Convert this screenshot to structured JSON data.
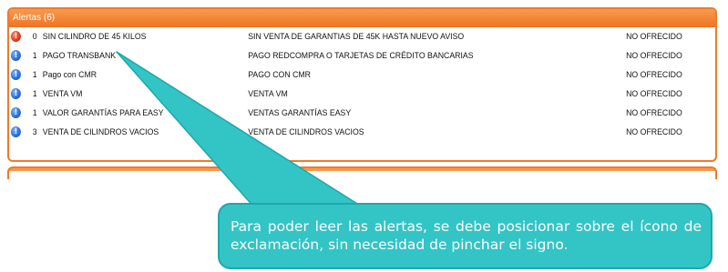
{
  "panel": {
    "title": "Alertas (6)",
    "rows": [
      {
        "icon": "alert-red-icon",
        "count": "0",
        "name": "SIN CILINDRO DE 45 KILOS",
        "description": "SIN VENTA DE GARANTIAS DE 45K HASTA NUEVO AVISO",
        "status": "NO OFRECIDO"
      },
      {
        "icon": "alert-blue-icon",
        "count": "1",
        "name": "PAGO TRANSBANK",
        "description": "PAGO REDCOMPRA O TARJETAS DE CRÉDITO BANCARIAS",
        "status": "NO OFRECIDO"
      },
      {
        "icon": "alert-blue-icon",
        "count": "1",
        "name": "Pago con CMR",
        "description": "PAGO CON CMR",
        "status": "NO OFRECIDO"
      },
      {
        "icon": "alert-blue-icon",
        "count": "1",
        "name": "VENTA VM",
        "description": "VENTA VM",
        "status": "NO OFRECIDO"
      },
      {
        "icon": "alert-blue-icon",
        "count": "1",
        "name": "VALOR GARANTÍAS PARA EASY",
        "description": "VENTAS GARANTÍAS EASY",
        "status": "NO OFRECIDO"
      },
      {
        "icon": "alert-blue-icon",
        "count": "3",
        "name": "VENTA DE CILINDROS VACIOS",
        "description": "VENTA DE CILINDROS VACIOS",
        "status": "NO OFRECIDO"
      }
    ]
  },
  "callout": {
    "text": "Para poder leer las alertas, se debe posicionar sobre el ícono de exclamación, sin necesidad de pinchar el signo."
  },
  "colors": {
    "panel_border": "#f07a28",
    "callout_fill": "#33c4c6",
    "alert_red": "#d62d0c",
    "alert_blue": "#1d5fd0"
  }
}
